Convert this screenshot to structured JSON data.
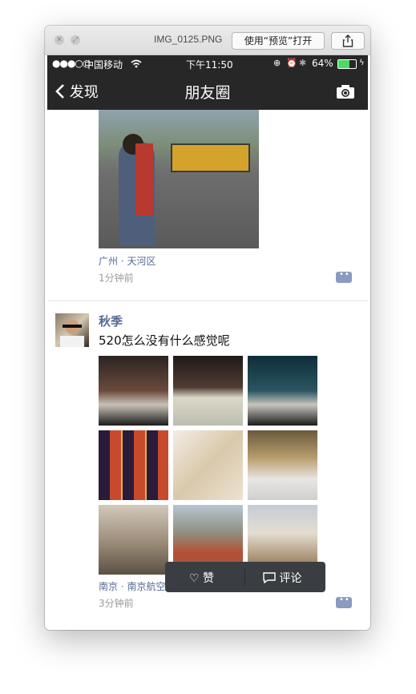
{
  "window": {
    "title": "IMG_0125.PNG",
    "open_with_label": "使用“预览”打开",
    "icons": {
      "close": "close-icon",
      "fullscreen": "fullscreen-icon",
      "share": "share-icon"
    }
  },
  "status_bar": {
    "signal": "●●●○○",
    "carrier": "中国移动",
    "time": "下午11:50",
    "battery": "64%",
    "battery_level": 0.64,
    "battery_color": "#4cd964"
  },
  "nav": {
    "back_label": "发现",
    "title": "朋友圈",
    "camera_icon": "camera-icon"
  },
  "posts": [
    {
      "location": "广州 · 天河区",
      "time": "1分钟前"
    },
    {
      "author": "秋季",
      "text": "520怎么没有什么感觉呢",
      "photo_count": 9,
      "location": "南京 · 南京航空航天大学",
      "time": "3分钟前"
    }
  ],
  "popup": {
    "like_label": "赞",
    "comment_label": "评论"
  },
  "colors": {
    "nav_bg": "#272727",
    "link": "#576b95",
    "popup_bg": "#3a3e42"
  }
}
